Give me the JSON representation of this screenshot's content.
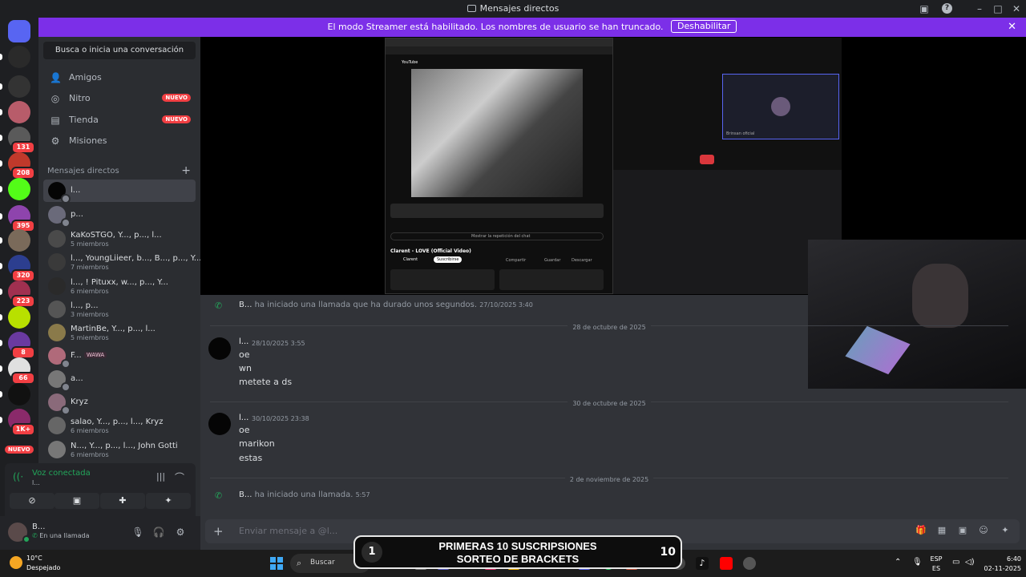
{
  "window": {
    "title": "Mensajes directos"
  },
  "banner": {
    "text": "El modo Streamer está habilitado. Los nombres de usuario se han truncado.",
    "button": "Deshabilitar",
    "color": "#7c2fe8"
  },
  "servers": [
    {
      "badge": "",
      "color": "#5865f2",
      "icon": "discord-logo-icon"
    },
    {
      "badge": "",
      "color": "#2a2a2a",
      "icon": "server-icon"
    },
    {
      "badge": "",
      "color": "#333333",
      "icon": "server-icon"
    },
    {
      "badge": "",
      "color": "#b85c6a",
      "icon": "server-icon"
    },
    {
      "badge": "131",
      "color": "#5a5a5a",
      "icon": "server-icon"
    },
    {
      "badge": "208",
      "color": "#c0392b",
      "icon": "server-icon"
    },
    {
      "badge": "",
      "color": "#53fc18",
      "icon": "kick-icon"
    },
    {
      "badge": "395",
      "color": "#8e44ad",
      "icon": "server-icon"
    },
    {
      "badge": "",
      "color": "#7a6a5a",
      "icon": "server-icon"
    },
    {
      "badge": "320",
      "color": "#2c3e8f",
      "icon": "server-icon"
    },
    {
      "badge": "223",
      "color": "#a03050",
      "icon": "server-icon"
    },
    {
      "badge": "",
      "color": "#b8e000",
      "icon": "server-icon"
    },
    {
      "badge": "8",
      "color": "#6a3aa0",
      "icon": "server-icon"
    },
    {
      "badge": "66",
      "color": "#e0e0e0",
      "icon": "server-icon"
    },
    {
      "badge": "",
      "color": "#111111",
      "icon": "server-icon"
    },
    {
      "badge": "1K+",
      "color": "#8a2a6a",
      "icon": "server-icon"
    }
  ],
  "rail_bottom": {
    "new_label": "NUEVO"
  },
  "sidebar": {
    "search": "Busca o inicia una conversación",
    "nav": [
      {
        "label": "Amigos",
        "badge": ""
      },
      {
        "label": "Nitro",
        "badge": "NUEVO"
      },
      {
        "label": "Tienda",
        "badge": "NUEVO"
      },
      {
        "label": "Misiones",
        "badge": ""
      }
    ],
    "dm_header": "Mensajes directos",
    "dms": [
      {
        "name": "l...",
        "sub": ""
      },
      {
        "name": "p...",
        "sub": ""
      },
      {
        "name": "KaKoSTGO, Y..., p..., l...",
        "sub": "5 miembros"
      },
      {
        "name": "l..., YoungLiieer, b..., B..., p..., Y...",
        "sub": "7 miembros"
      },
      {
        "name": "l..., ! Pituxx, w..., p..., Y...",
        "sub": "6 miembros"
      },
      {
        "name": "l..., p...",
        "sub": "3 miembros"
      },
      {
        "name": "MartinBe, Y..., p..., l...",
        "sub": "5 miembros"
      },
      {
        "name": "F...",
        "sub": "",
        "tag": "WAWA"
      },
      {
        "name": "a...",
        "sub": ""
      },
      {
        "name": "Kryz",
        "sub": ""
      },
      {
        "name": "salao, Y..., p..., l..., Kryz",
        "sub": "6 miembros"
      },
      {
        "name": "N..., Y..., p..., l..., John Gotti",
        "sub": "6 miembros"
      }
    ]
  },
  "voice": {
    "title": "Voz conectada",
    "sub": "l..."
  },
  "user": {
    "name": "B...",
    "status": "En una llamada"
  },
  "messages": {
    "call1": {
      "author": "B...",
      "text": "ha iniciado una llamada que ha durado unos segundos.",
      "time": "27/10/2025 3:40"
    },
    "divider1": "28 de octubre de 2025",
    "group1": {
      "author": "l...",
      "time": "28/10/2025 3:55",
      "lines": [
        "oe",
        "wn",
        "metete a ds"
      ]
    },
    "divider2": "30 de octubre de 2025",
    "group2": {
      "author": "l...",
      "time": "30/10/2025 23:38",
      "lines": [
        "oe",
        "marikon",
        "estas"
      ]
    },
    "divider3": "2 de noviembre de 2025",
    "call2": {
      "author": "B...",
      "text": "ha iniciado una llamada.",
      "time": "5:57"
    }
  },
  "composer": {
    "placeholder": "Enviar mensaje a @l..."
  },
  "stream_screenshot": {
    "video_title": "Clarent - LOVE (Official Video)",
    "yt_logo": "YouTube",
    "channel": "Clarent",
    "subscribe": "Suscribirse",
    "share": "Compartir",
    "save": "Guardar",
    "download": "Descargar",
    "live_chat": "Mostrar la repetición del chat",
    "tile_name": "Brinsan oficial"
  },
  "overlay": {
    "line1": "PRIMERAS 10 SUSCRIPSIONES",
    "line2": "SORTEO DE BRACKETS",
    "left_num": "1",
    "right_num": "10"
  },
  "taskbar": {
    "temp": "10°C",
    "weather": "Despejado",
    "search": "Buscar",
    "lang1": "ESP",
    "lang2": "ES",
    "time": "6:40",
    "date": "02-11-2025"
  }
}
